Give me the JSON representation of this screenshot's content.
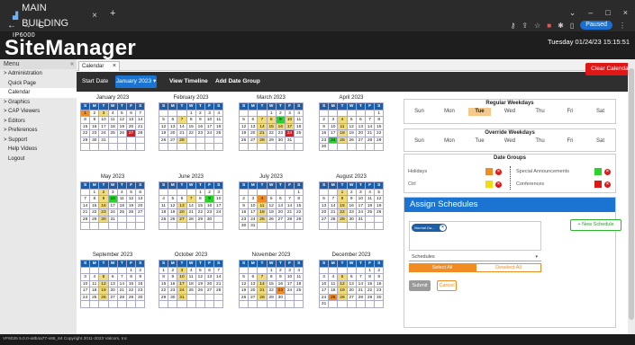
{
  "browser": {
    "tab_title": "MAIN BUILDING",
    "tab_close": "×",
    "new_tab": "+",
    "nav_back": "←",
    "nav_forward": "→",
    "nav_reload": "C",
    "paused_label": "Paused",
    "win_min": "–",
    "win_max": "□",
    "win_close": "×"
  },
  "header": {
    "product_sub": "IP6000",
    "product_name": "SiteManager",
    "datetime": "Tuesday 01/24/23 15:15:51"
  },
  "sidebar": {
    "title": "Menu",
    "collapse": "«",
    "items": [
      {
        "label": "> Administration",
        "sub": false,
        "active": false
      },
      {
        "label": "Quick Page",
        "sub": true,
        "active": false
      },
      {
        "label": "Calendar",
        "sub": true,
        "active": true
      },
      {
        "label": "> Graphics",
        "sub": false,
        "active": false
      },
      {
        "label": "> CAP Viewers",
        "sub": false,
        "active": false
      },
      {
        "label": "> Editors",
        "sub": false,
        "active": false
      },
      {
        "label": "> Preferences",
        "sub": false,
        "active": false
      },
      {
        "label": "> Support",
        "sub": false,
        "active": false
      },
      {
        "label": "Help Videos",
        "sub": true,
        "active": false
      },
      {
        "label": "Logout",
        "sub": true,
        "active": false
      }
    ]
  },
  "tabs": {
    "calendar_tab": "Calendar",
    "close": "×"
  },
  "toolbar": {
    "start_date_label": "Start Date",
    "month_button": "January 2023 ▾",
    "view_timeline": "View Timeline",
    "add_date_group": "Add Date Group",
    "clear_calendar": "Clear Calendar"
  },
  "calendar": {
    "day_headers": [
      "S",
      "M",
      "T",
      "W",
      "T",
      "F",
      "S"
    ],
    "months": [
      {
        "title": "January 2023",
        "start": 0,
        "days": 31,
        "marks": {
          "1": "orange",
          "3": "yellow",
          "27": "red"
        }
      },
      {
        "title": "February 2023",
        "start": 3,
        "days": 28,
        "marks": {
          "7": "yellow",
          "28": "yellow"
        }
      },
      {
        "title": "March 2023",
        "start": 3,
        "days": 31,
        "marks": {
          "7": "yellow",
          "8": "yellow",
          "9": "green",
          "10": "yellow",
          "14": "yellow",
          "15": "yellow",
          "16": "yellow",
          "17": "yellow",
          "21": "yellow",
          "24": "red",
          "28": "yellow"
        }
      },
      {
        "title": "April 2023",
        "start": 6,
        "days": 30,
        "marks": {
          "4": "yellow",
          "11": "yellow",
          "18": "yellow",
          "24": "green",
          "25": "yellow"
        }
      },
      {
        "title": "May 2023",
        "start": 1,
        "days": 31,
        "marks": {
          "2": "yellow",
          "9": "yellow",
          "10": "green",
          "16": "yellow",
          "23": "yellow",
          "30": "yellow"
        }
      },
      {
        "title": "June 2023",
        "start": 4,
        "days": 30,
        "marks": {
          "7": "yellow",
          "9": "green",
          "13": "yellow",
          "20": "yellow",
          "27": "yellow"
        }
      },
      {
        "title": "July 2023",
        "start": 6,
        "days": 31,
        "marks": {
          "4": "orange",
          "11": "yellow",
          "18": "yellow",
          "25": "yellow"
        }
      },
      {
        "title": "August 2023",
        "start": 2,
        "days": 31,
        "marks": {
          "1": "yellow",
          "8": "yellow",
          "15": "yellow",
          "22": "yellow",
          "29": "yellow"
        }
      },
      {
        "title": "September 2023",
        "start": 5,
        "days": 30,
        "marks": {
          "5": "yellow",
          "12": "yellow",
          "19": "yellow",
          "26": "yellow"
        }
      },
      {
        "title": "October 2023",
        "start": 0,
        "days": 31,
        "marks": {
          "3": "yellow",
          "10": "yellow",
          "17": "yellow",
          "24": "yellow",
          "31": "yellow"
        }
      },
      {
        "title": "November 2023",
        "start": 3,
        "days": 30,
        "marks": {
          "7": "yellow",
          "14": "yellow",
          "21": "yellow",
          "23": "orange",
          "28": "yellow"
        }
      },
      {
        "title": "December 2023",
        "start": 5,
        "days": 31,
        "marks": {
          "5": "yellow",
          "12": "yellow",
          "19": "yellow",
          "25": "orange",
          "26": "yellow"
        }
      }
    ]
  },
  "regular_weekdays": {
    "title": "Regular Weekdays",
    "days": [
      {
        "label": "Sun",
        "selected": false
      },
      {
        "label": "Mon",
        "selected": false
      },
      {
        "label": "Tue",
        "selected": true
      },
      {
        "label": "Wed",
        "selected": false
      },
      {
        "label": "Thu",
        "selected": false
      },
      {
        "label": "Fri",
        "selected": false
      },
      {
        "label": "Sat",
        "selected": false
      }
    ]
  },
  "override_weekdays": {
    "title": "Override Weekdays",
    "days": [
      "Sun",
      "Mon",
      "Tue",
      "Wed",
      "Thu",
      "Fri",
      "Sat"
    ]
  },
  "date_groups": {
    "title": "Date Groups",
    "items": [
      {
        "label": "Holidays",
        "color": "#f08c22"
      },
      {
        "label": "Special Announcements",
        "color": "#2cd12c"
      },
      {
        "label": "Ctrl",
        "color": "#f1dc12"
      },
      {
        "label": "Conferences",
        "color": "#e01717"
      }
    ],
    "delete_glyph": "×"
  },
  "assign": {
    "title": "Assign Schedules",
    "chip_label": "Normal Da...",
    "chip_close": "×",
    "new_schedule": "+ New Schedule",
    "select_value": "Schedules",
    "select_caret": "▾",
    "select_all": "Select All",
    "deselect_all": "Deselect All",
    "submit": "Submit",
    "cancel": "Cancel"
  },
  "colors": {
    "orange": "#f08c22",
    "yellow": "#f1dc78",
    "green": "#2cd12c",
    "red": "#e01717",
    "accent_blue": "#1b74d2"
  },
  "footer": {
    "text": "VF6025 5.0.0-a8b4a77-x86_64 Copyright 2011-2023 Valcom, Inc"
  }
}
